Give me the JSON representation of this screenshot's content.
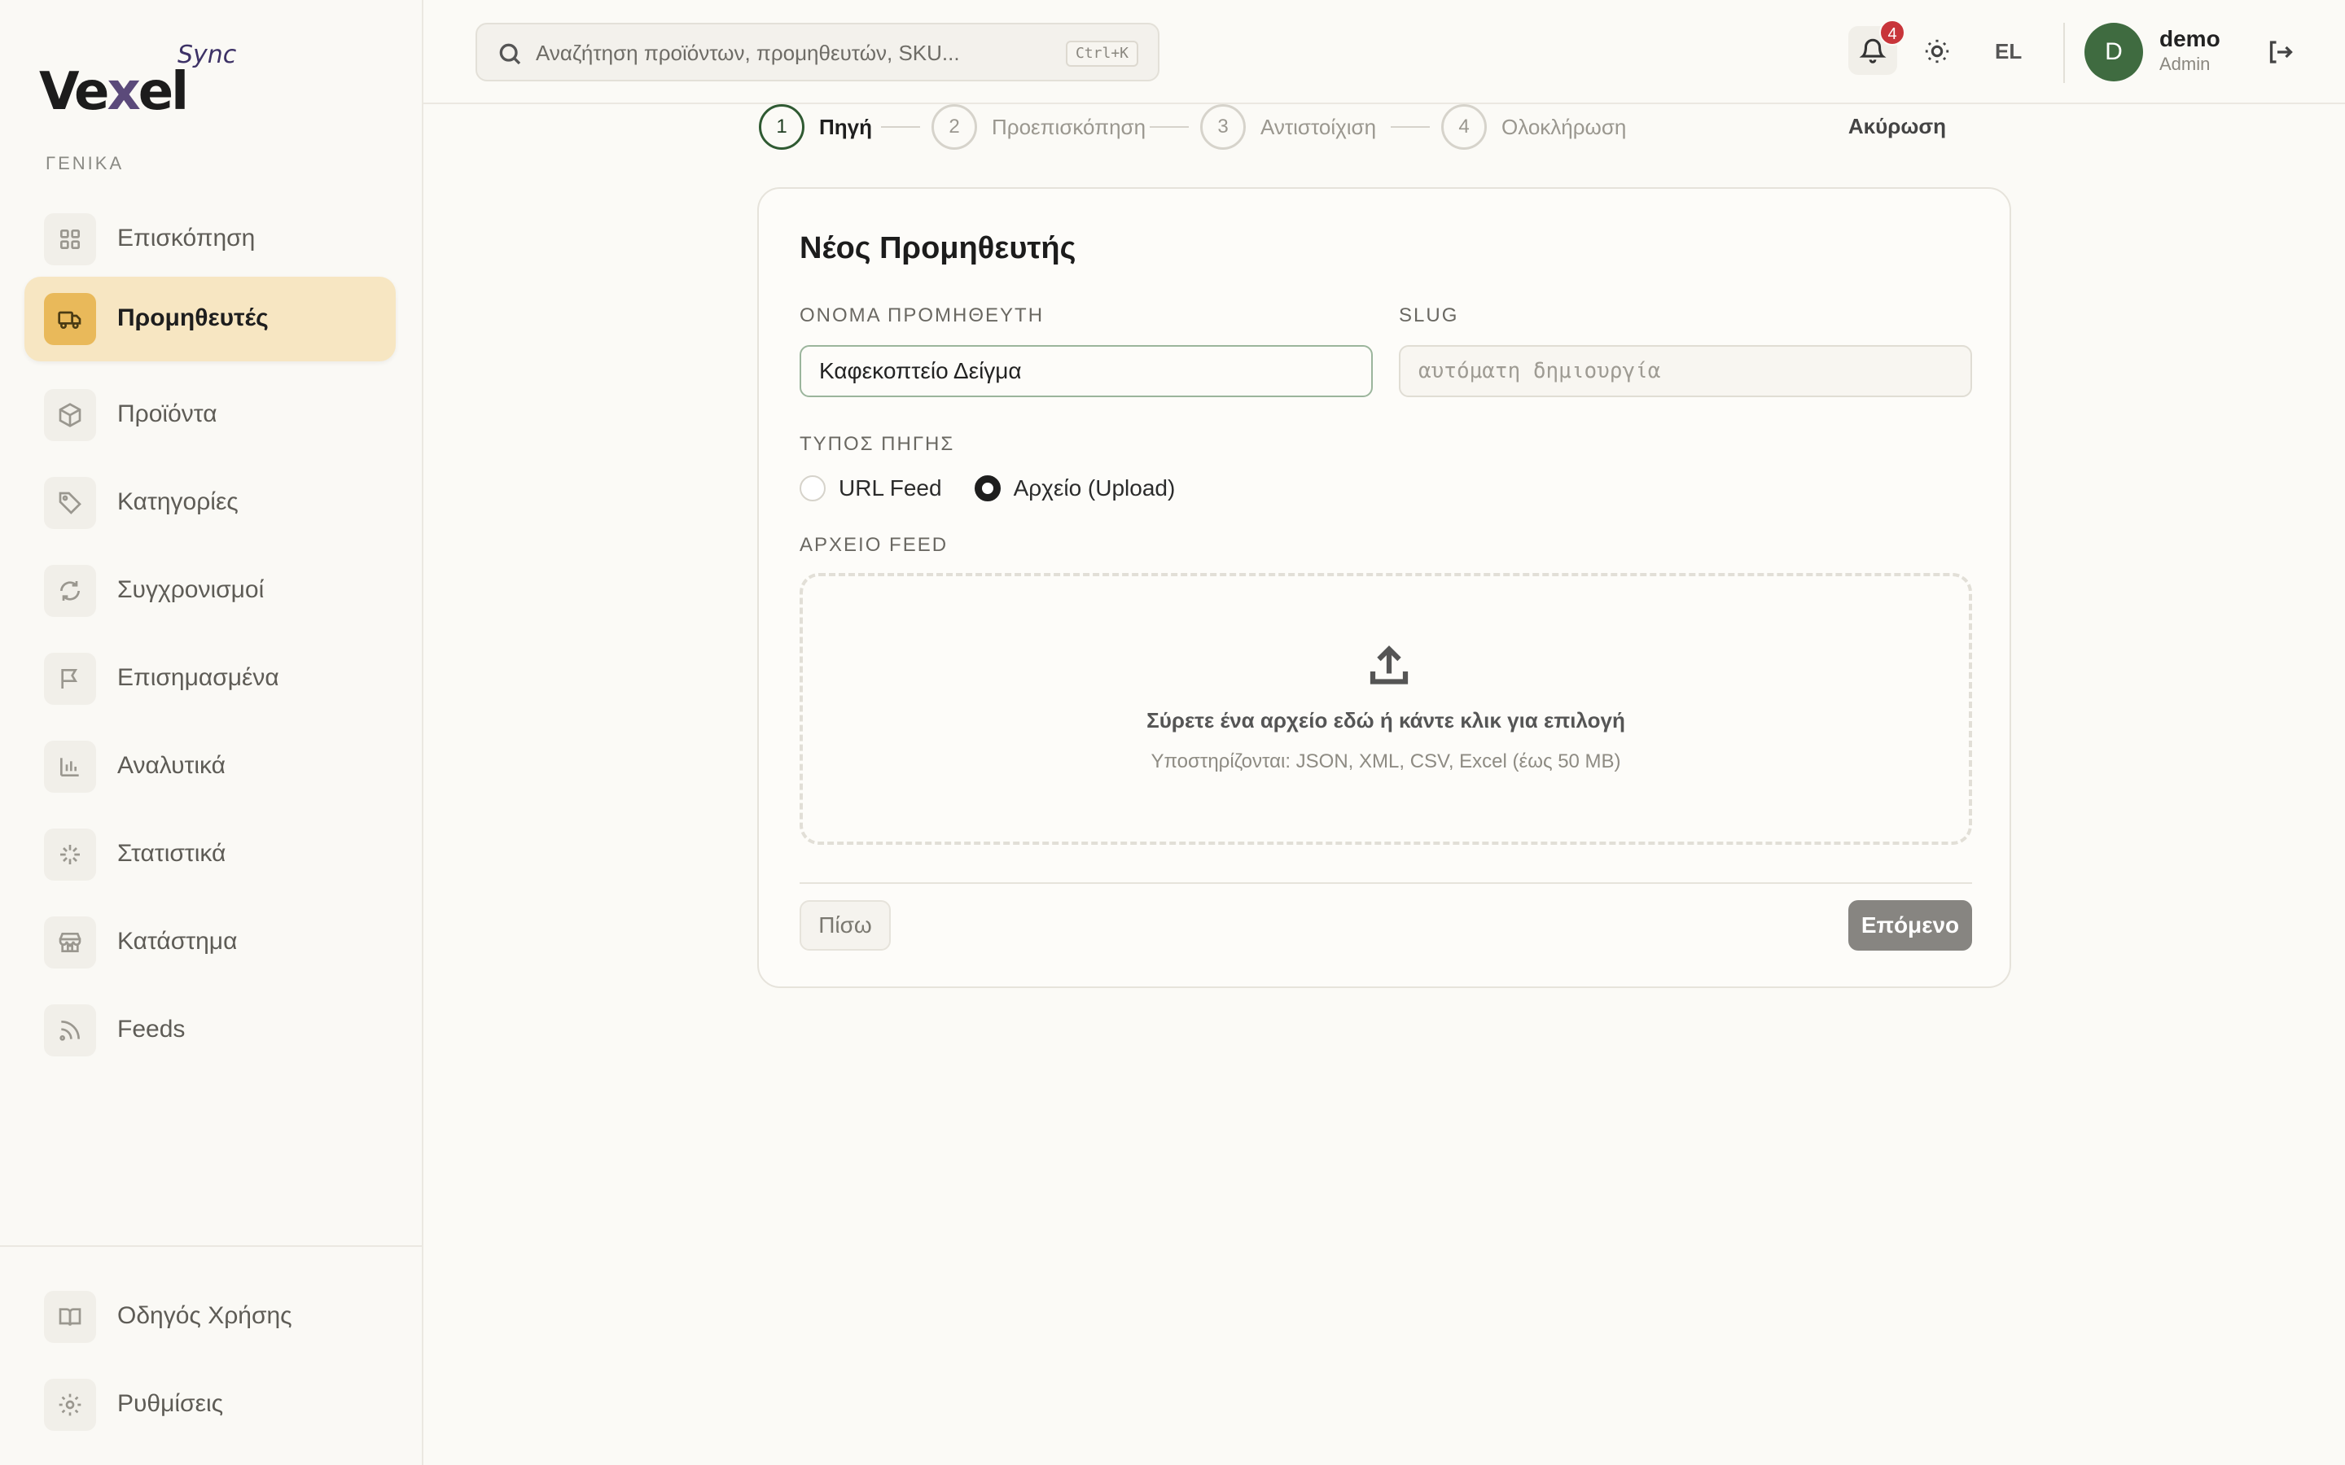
{
  "brand": {
    "name_pre": "Ve",
    "name_x": "x",
    "name_post": "el",
    "sync": "Sync"
  },
  "sidebar": {
    "section_label": "ΓΕΝΙΚΑ",
    "items": [
      {
        "label": "Επισκόπηση",
        "icon": "grid-icon"
      },
      {
        "label": "Προμηθευτές",
        "icon": "truck-icon",
        "active": true
      },
      {
        "label": "Προϊόντα",
        "icon": "box-icon"
      },
      {
        "label": "Κατηγορίες",
        "icon": "tag-icon"
      },
      {
        "label": "Συγχρονισμοί",
        "icon": "refresh-icon"
      },
      {
        "label": "Επισημασμένα",
        "icon": "flag-icon"
      },
      {
        "label": "Αναλυτικά",
        "icon": "bar-chart-icon"
      },
      {
        "label": "Στατιστικά",
        "icon": "sparkle-icon"
      },
      {
        "label": "Κατάστημα",
        "icon": "store-icon"
      },
      {
        "label": "Feeds",
        "icon": "rss-icon"
      }
    ],
    "bottom_items": [
      {
        "label": "Οδηγός Χρήσης",
        "icon": "book-icon"
      },
      {
        "label": "Ρυθμίσεις",
        "icon": "gear-icon"
      }
    ]
  },
  "topbar": {
    "search_placeholder": "Αναζήτηση προϊόντων, προμηθευτών, SKU...",
    "search_shortcut": "Ctrl+K",
    "notifications_count": "4",
    "language": "EL",
    "user": {
      "initial": "D",
      "name": "demo",
      "role": "Admin"
    }
  },
  "stepper": {
    "steps": [
      {
        "num": "1",
        "label": "Πηγή",
        "active": true
      },
      {
        "num": "2",
        "label": "Προεπισκόπηση"
      },
      {
        "num": "3",
        "label": "Αντιστοίχιση"
      },
      {
        "num": "4",
        "label": "Ολοκλήρωση"
      }
    ],
    "cancel_label": "Ακύρωση"
  },
  "form": {
    "title": "Νέος Προμηθευτής",
    "name_label": "ΟΝΟΜΑ ΠΡΟΜΗΘΕΥΤΗ",
    "name_value": "Καφεκοπτείο Δείγμα",
    "slug_label": "SLUG",
    "slug_placeholder": "αυτόματη δημιουργία",
    "source_type_label": "ΤΥΠΟΣ ΠΗΓΗΣ",
    "source_options": [
      {
        "label": "URL Feed",
        "checked": false
      },
      {
        "label": "Αρχείο (Upload)",
        "checked": true
      }
    ],
    "file_label": "ΑΡΧΕΙΟ FEED",
    "dropzone_title": "Σύρετε ένα αρχείο εδώ ή κάντε κλικ για επιλογή",
    "dropzone_hint": "Υποστηρίζονται: JSON, XML, CSV, Excel (έως 50 MB)",
    "back_label": "Πίσω",
    "next_label": "Επόμενο"
  },
  "colors": {
    "accent_active_bg": "#f7e6c2",
    "accent_active_icon": "#e9b95a",
    "avatar": "#3f6b40",
    "badge": "#c8353a",
    "next_button": "#878581"
  }
}
